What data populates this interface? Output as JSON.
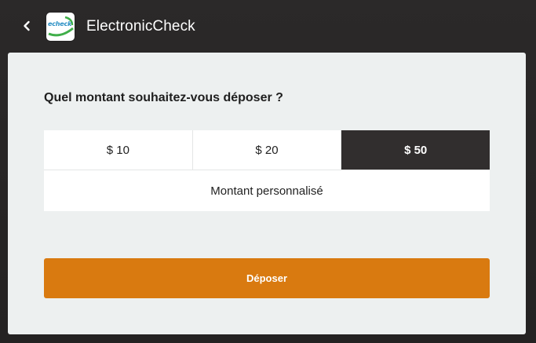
{
  "header": {
    "back_icon": "chevron-left-icon",
    "logo_text": "echeck",
    "title": "ElectronicCheck"
  },
  "deposit": {
    "question": "Quel montant souhaitez-vous déposer ?",
    "amounts": [
      {
        "label": "$ 10",
        "selected": false
      },
      {
        "label": "$ 20",
        "selected": false
      },
      {
        "label": "$ 50",
        "selected": true
      }
    ],
    "custom_label": "Montant personnalisé",
    "submit_label": "Déposer"
  },
  "colors": {
    "background": "#262424",
    "panel": "#edf0f0",
    "selected_amount": "#312e2e",
    "primary_button": "#d97a10",
    "logo_accent": "#2a8fc4"
  }
}
